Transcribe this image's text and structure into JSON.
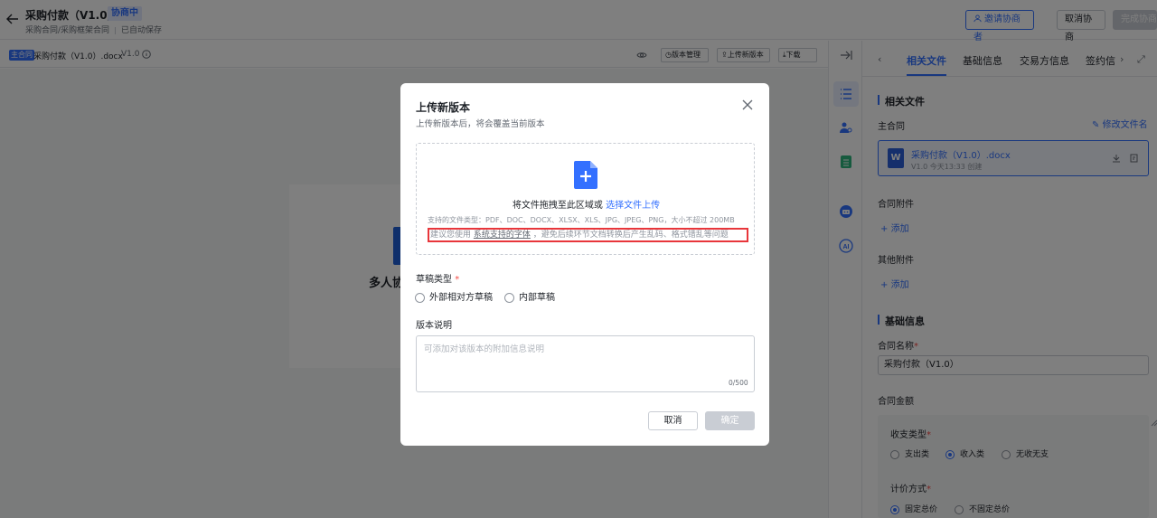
{
  "header": {
    "title": "采购付款（V1.0）",
    "status": "协商中",
    "subtitle_breadcrumb": "采购合同/采购框架合同",
    "subtitle_save": "已自动保存",
    "invite_label": "邀请协商者",
    "cancel_collab_label": "取消协商",
    "complete_label": "完成协商"
  },
  "toolbar": {
    "main_tag": "主合同",
    "file_name": "采购付款（V1.0）.docx",
    "version": "V1.0",
    "version_manage": "版本管理",
    "upload_new": "上传新版本",
    "download": "下载"
  },
  "doc": {
    "card_title": "多人协"
  },
  "panel": {
    "tabs": [
      "相关文件",
      "基础信息",
      "交易方信息",
      "签约信"
    ],
    "related_title": "相关文件",
    "main_contract_label": "主合同",
    "rename_label": "修改文件名",
    "file": {
      "name": "采购付款（V1.0）.docx",
      "meta": "V1.0 今天13:33 创建"
    },
    "attachments_label": "合同附件",
    "add_label": "添加",
    "other_attachments_label": "其他附件",
    "add_label2": "添加",
    "basic_title": "基础信息",
    "contract_name_label": "合同名称",
    "contract_name_value": "采购付款（V1.0）",
    "amount_label": "合同金额",
    "income_type_label": "收支类型",
    "income_options": [
      "支出类",
      "收入类",
      "无收无支"
    ],
    "income_selected": "收入类",
    "pricing_label": "计价方式",
    "pricing_options": [
      "固定总价",
      "不固定总价"
    ],
    "pricing_selected": "固定总价"
  },
  "modal": {
    "title": "上传新版本",
    "subtitle": "上传新版本后，将会覆盖当前版本",
    "drop_text": "将文件拖拽至此区域或",
    "drop_link": "选择文件上传",
    "types_text": "支持的文件类型：PDF、DOC、DOCX、XLSX、XLS、JPG、JPEG、PNG，大小不超过 200MB",
    "warn_prefix": "建议您使用",
    "warn_link": "系统支持的字体",
    "warn_suffix": "，避免后续环节文档转换后产生乱码、格式错乱等问题",
    "draft_type_label": "草稿类型",
    "draft_options": [
      "外部相对方草稿",
      "内部草稿"
    ],
    "note_label": "版本说明",
    "note_placeholder": "可添加对该版本的附加信息说明",
    "note_count": "0/500",
    "cancel_label": "取消",
    "ok_label": "确定"
  },
  "colors": {
    "accent": "#3370ff",
    "warning_border": "#e8363b"
  }
}
